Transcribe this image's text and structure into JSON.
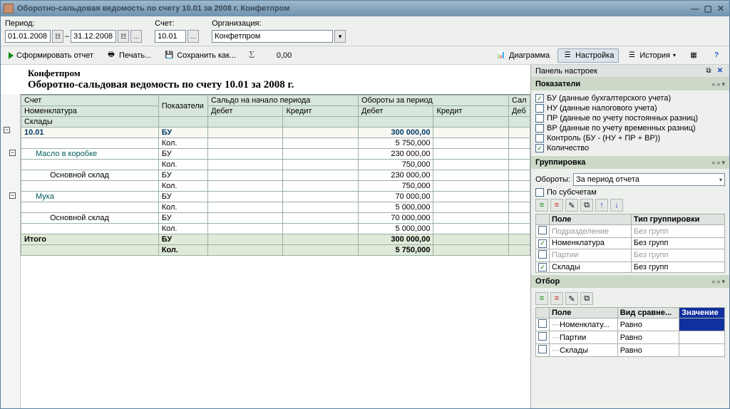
{
  "window": {
    "title": "Оборотно-сальдовая ведомость по счету 10.01 за 2008 г. Конфетпром"
  },
  "params": {
    "period_label": "Период:",
    "date_from": "01.01.2008",
    "date_to": "31.12.2008",
    "account_label": "Счет:",
    "account": "10.01",
    "org_label": "Организация:",
    "org": "Конфетпром"
  },
  "toolbar": {
    "form_report": "Сформировать отчет",
    "print": "Печать...",
    "save_as": "Сохранить как...",
    "sum_value": "0,00",
    "diagram": "Диаграмма",
    "settings": "Настройка",
    "history": "История"
  },
  "report": {
    "org_name": "Конфетпром",
    "title": "Оборотно-сальдовая ведомость по счету 10.01 за 2008 г.",
    "cols": {
      "account": "Счет",
      "indicators": "Показатели",
      "balance_begin": "Сальдо на начало периода",
      "turnover": "Обороты за период",
      "balance_end": "Сал",
      "nomenclature": "Номенклатура",
      "warehouses": "Склады",
      "debit": "Дебет",
      "credit": "Кредит",
      "debit2": "Деб"
    },
    "rows": {
      "r0": {
        "acct": "10.01",
        "ind": "БУ",
        "td": "300 000,00"
      },
      "r1": {
        "ind": "Кол.",
        "td": "5 750,000"
      },
      "r2": {
        "name": "Масло в коробке",
        "ind": "БУ",
        "td": "230 000,00"
      },
      "r3": {
        "ind": "Кол.",
        "td": "750,000"
      },
      "r4": {
        "name": "Основной склад",
        "ind": "БУ",
        "td": "230 000,00"
      },
      "r5": {
        "ind": "Кол.",
        "td": "750,000"
      },
      "r6": {
        "name": "Мука",
        "ind": "БУ",
        "td": "70 000,00"
      },
      "r7": {
        "ind": "Кол.",
        "td": "5 000,000"
      },
      "r8": {
        "name": "Основной склад",
        "ind": "БУ",
        "td": "70 000,000"
      },
      "r9": {
        "ind": "Кол.",
        "td": "5 000,000"
      },
      "t0": {
        "name": "Итого",
        "ind": "БУ",
        "td": "300 000,00"
      },
      "t1": {
        "ind": "Кол.",
        "td": "5 750,000"
      }
    }
  },
  "settings_panel": {
    "title": "Панель настроек",
    "indicators": {
      "title": "Показатели",
      "items": {
        "bu": "БУ (данные бухгалтерского учета)",
        "nu": "НУ (данные налогового учета)",
        "pr": "ПР (данные по учету постоянных разниц)",
        "vr": "ВР (данные по учету временных разниц)",
        "ctrl": "Контроль (БУ - (НУ + ПР + ВР))",
        "qty": "Количество"
      }
    },
    "grouping": {
      "title": "Группировка",
      "turnover_label": "Обороты:",
      "turnover_value": "За период отчета",
      "subaccounts": "По субсчетам",
      "field_col": "Поле",
      "type_col": "Тип группировки",
      "rows": {
        "r0": {
          "field": "Подразделение",
          "type": "Без групп"
        },
        "r1": {
          "field": "Номенклатура",
          "type": "Без групп"
        },
        "r2": {
          "field": "Партии",
          "type": "Без групп"
        },
        "r3": {
          "field": "Склады",
          "type": "Без групп"
        }
      }
    },
    "filter": {
      "title": "Отбор",
      "field_col": "Поле",
      "cmp_col": "Вид сравне...",
      "val_col": "Значение",
      "rows": {
        "r0": {
          "field": "Номенклату...",
          "cmp": "Равно"
        },
        "r1": {
          "field": "Партии",
          "cmp": "Равно"
        },
        "r2": {
          "field": "Склады",
          "cmp": "Равно"
        }
      }
    }
  }
}
